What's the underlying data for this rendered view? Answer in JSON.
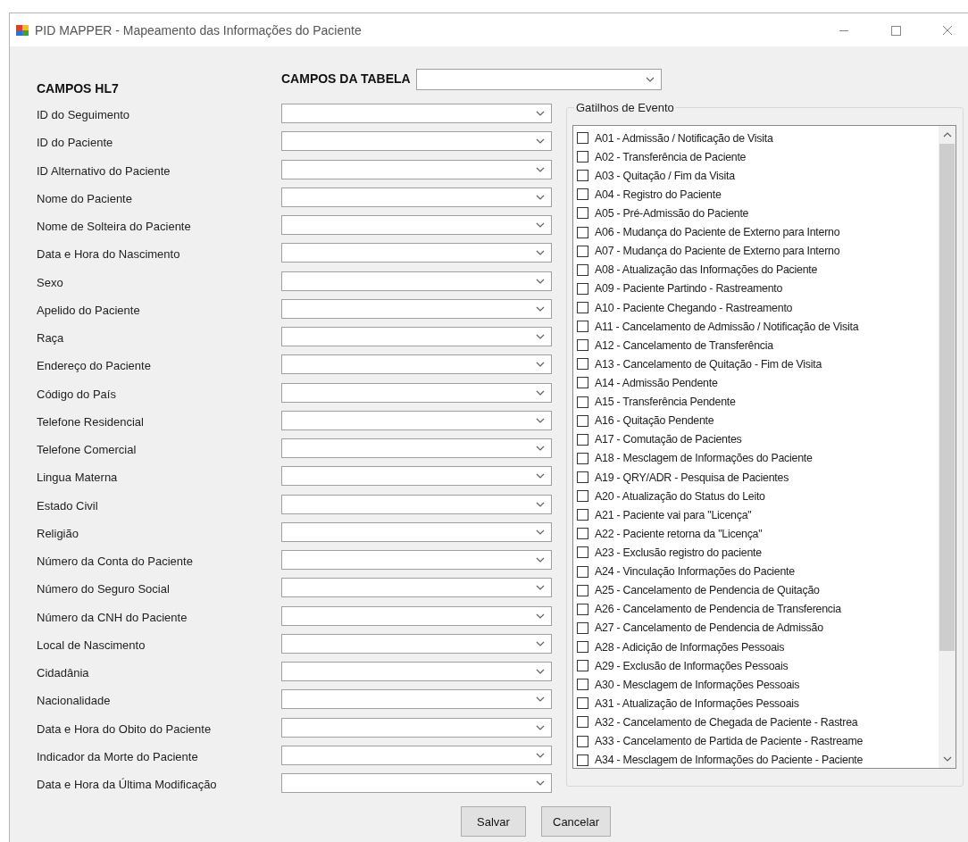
{
  "window": {
    "title": "PID MAPPER - Mapeamento das Informações do Paciente"
  },
  "header": {
    "hl7_title": "CAMPOS HL7",
    "table_label": "CAMPOS DA TABELA"
  },
  "fields": [
    {
      "label": "ID do Seguimento"
    },
    {
      "label": "ID do Paciente"
    },
    {
      "label": "ID Alternativo do Paciente"
    },
    {
      "label": "Nome do Paciente"
    },
    {
      "label": "Nome de Solteira do Paciente"
    },
    {
      "label": "Data e Hora do Nascimento"
    },
    {
      "label": "Sexo"
    },
    {
      "label": "Apelido do Paciente"
    },
    {
      "label": "Raça"
    },
    {
      "label": "Endereço do Paciente"
    },
    {
      "label": "Código do País"
    },
    {
      "label": "Telefone Residencial"
    },
    {
      "label": "Telefone Comercial"
    },
    {
      "label": "Lingua Materna"
    },
    {
      "label": "Estado Civil"
    },
    {
      "label": "Religião"
    },
    {
      "label": "Número da Conta do Paciente"
    },
    {
      "label": "Número do Seguro Social"
    },
    {
      "label": "Número da CNH do Paciente"
    },
    {
      "label": "Local de Nascimento"
    },
    {
      "label": "Cidadânia"
    },
    {
      "label": "Nacionalidade"
    },
    {
      "label": "Data e Hora do Obito do Paciente"
    },
    {
      "label": "Indicador da Morte do Paciente"
    },
    {
      "label": "Data e Hora da Última Modificação"
    }
  ],
  "event_triggers": {
    "title": "Gatilhos de Evento",
    "items": [
      {
        "label": "A01 - Admissão / Notificação de Visita",
        "checked": false
      },
      {
        "label": "A02 - Transferência de Paciente",
        "checked": false
      },
      {
        "label": "A03 - Quitação / Fim da Visita",
        "checked": false
      },
      {
        "label": "A04 - Registro do Paciente",
        "checked": false
      },
      {
        "label": "A05 - Pré-Admissão do Paciente",
        "checked": false
      },
      {
        "label": "A06 - Mudança do Paciente de Externo para Interno",
        "checked": false
      },
      {
        "label": "A07 - Mudança do Paciente de Externo para Interno",
        "checked": false
      },
      {
        "label": "A08 - Atualização das Informações do Paciente",
        "checked": false
      },
      {
        "label": "A09 - Paciente Partindo - Rastreamento",
        "checked": false
      },
      {
        "label": "A10 - Paciente Chegando - Rastreamento",
        "checked": false
      },
      {
        "label": "A11 - Cancelamento de Admissão / Notificação de Visita",
        "checked": false
      },
      {
        "label": "A12 - Cancelamento de Transferência",
        "checked": false
      },
      {
        "label": "A13 - Cancelamento de Quitação - Fim de Visita",
        "checked": false
      },
      {
        "label": "A14 - Admissão Pendente",
        "checked": false
      },
      {
        "label": "A15 - Transferência Pendente",
        "checked": false
      },
      {
        "label": "A16 - Quitação Pendente",
        "checked": false
      },
      {
        "label": "A17 - Comutação de Pacientes",
        "checked": false
      },
      {
        "label": "A18 - Mesclagem de Informações do Paciente",
        "checked": false
      },
      {
        "label": "A19 - QRY/ADR - Pesquisa de Pacientes",
        "checked": false
      },
      {
        "label": "A20 - Atualização do Status do Leito",
        "checked": false
      },
      {
        "label": "A21 - Paciente vai para \"Licença\"",
        "checked": false
      },
      {
        "label": "A22 - Paciente retorna da \"Licença\"",
        "checked": false
      },
      {
        "label": "A23 - Exclusão registro do paciente",
        "checked": false
      },
      {
        "label": "A24 - Vinculação Informações do Paciente",
        "checked": false
      },
      {
        "label": "A25 - Cancelamento de Pendencia de Quitação",
        "checked": false
      },
      {
        "label": "A26 - Cancelamento de Pendencia de Transferencia",
        "checked": false
      },
      {
        "label": "A27 - Cancelamento de Pendencia de Admissão",
        "checked": false
      },
      {
        "label": "A28 - Adicição de Informações Pessoais",
        "checked": false
      },
      {
        "label": "A29 - Exclusão de Informações Pessoais",
        "checked": false
      },
      {
        "label": "A30 - Mesclagem de Informações Pessoais",
        "checked": false
      },
      {
        "label": "A31 - Atualização de Informações Pessoais",
        "checked": false
      },
      {
        "label": "A32 - Cancelamento de Chegada de Paciente - Rastrea",
        "checked": false
      },
      {
        "label": "A33 - Cancelamento de Partida de Paciente - Rastreame",
        "checked": false
      },
      {
        "label": "A34 - Mesclagem de Informações do Paciente - Paciente",
        "checked": false
      }
    ]
  },
  "buttons": [
    {
      "label": "Salvar"
    },
    {
      "label": "Cancelar"
    }
  ]
}
